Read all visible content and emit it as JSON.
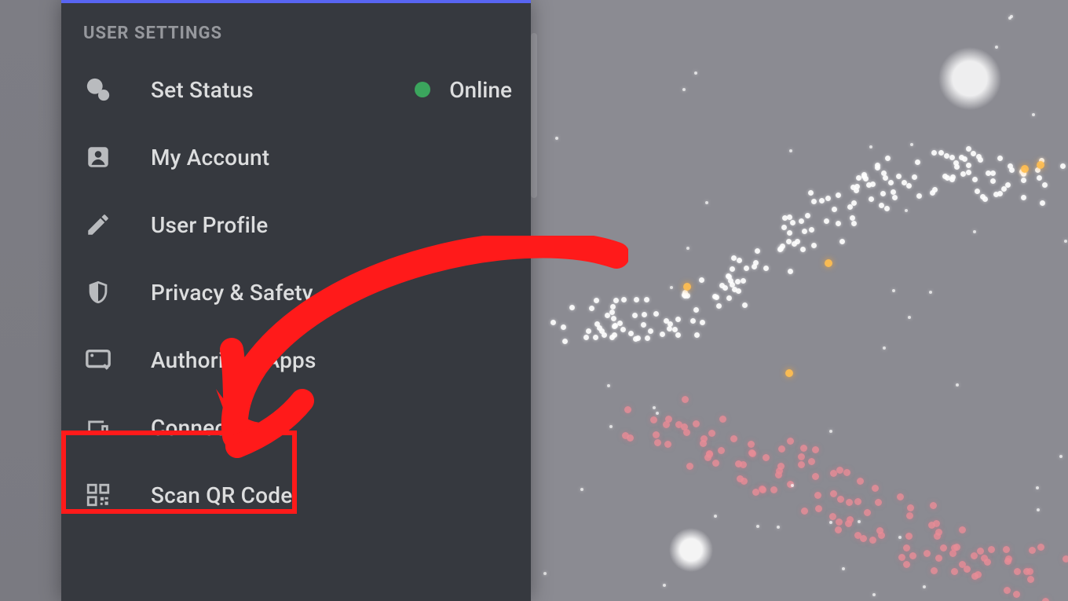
{
  "panel": {
    "header": "USER SETTINGS",
    "items": [
      {
        "id": "set-status",
        "label": "Set Status",
        "status_label": "Online"
      },
      {
        "id": "my-account",
        "label": "My Account"
      },
      {
        "id": "user-profile",
        "label": "User Profile"
      },
      {
        "id": "privacy-safety",
        "label": "Privacy & Safety"
      },
      {
        "id": "authorized-apps",
        "label": "Authorized Apps"
      },
      {
        "id": "connections",
        "label": "Connections"
      },
      {
        "id": "scan-qr",
        "label": "Scan QR Code"
      }
    ]
  },
  "annotation": {
    "target_item_id": "connections",
    "highlight_color": "#ff1a1a"
  },
  "status": {
    "online_dot_color": "#3ba55d"
  },
  "background": {
    "description": "blurred particle/drone-light bird shape over grey"
  }
}
